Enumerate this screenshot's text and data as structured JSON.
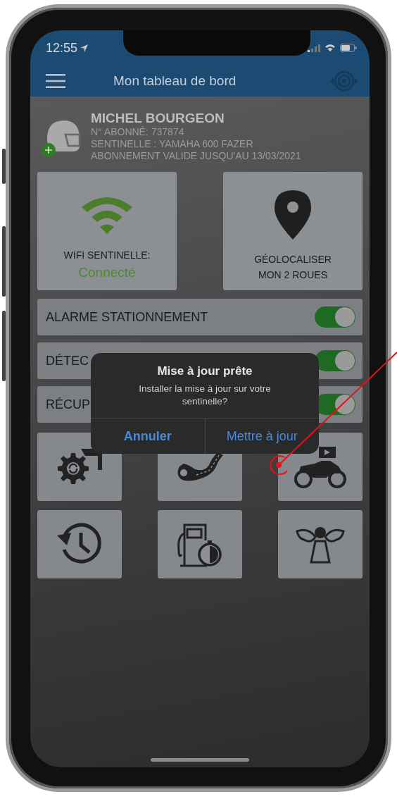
{
  "status_bar": {
    "time": "12:55"
  },
  "header": {
    "title": "Mon tableau de bord"
  },
  "profile": {
    "name": "MICHEL BOURGEON",
    "lines": [
      "N° ABONNÉ: 737874",
      "SENTINELLE : YAMAHA 600 FAZER",
      "ABONNEMENT VALIDE JUSQU'AU 13/03/2021"
    ]
  },
  "tiles": [
    {
      "kind": "wifi",
      "lines": [
        "WIFI SENTINELLE:"
      ],
      "status": "Connecté"
    },
    {
      "kind": "location",
      "lines": [
        "GÉOLOCALISER",
        "MON 2 ROUES"
      ]
    }
  ],
  "toggles": [
    {
      "label": "ALARME STATIONNEMENT",
      "on": true
    },
    {
      "label": "DÉTEC",
      "on": true
    },
    {
      "label": "RÉCUP",
      "on": true
    }
  ],
  "shortcuts": [
    {
      "kind": "maintenance"
    },
    {
      "kind": "route"
    },
    {
      "kind": "motorcycle"
    },
    {
      "kind": "history"
    },
    {
      "kind": "fuel"
    },
    {
      "kind": "angel"
    }
  ],
  "dialog": {
    "title": "Mise à jour prête",
    "message": "Installer la mise à jour sur votre sentinelle?",
    "buttons": [
      {
        "label": "Annuler",
        "kind": "cancel"
      },
      {
        "label": "Mettre à jour",
        "kind": "default"
      }
    ]
  }
}
